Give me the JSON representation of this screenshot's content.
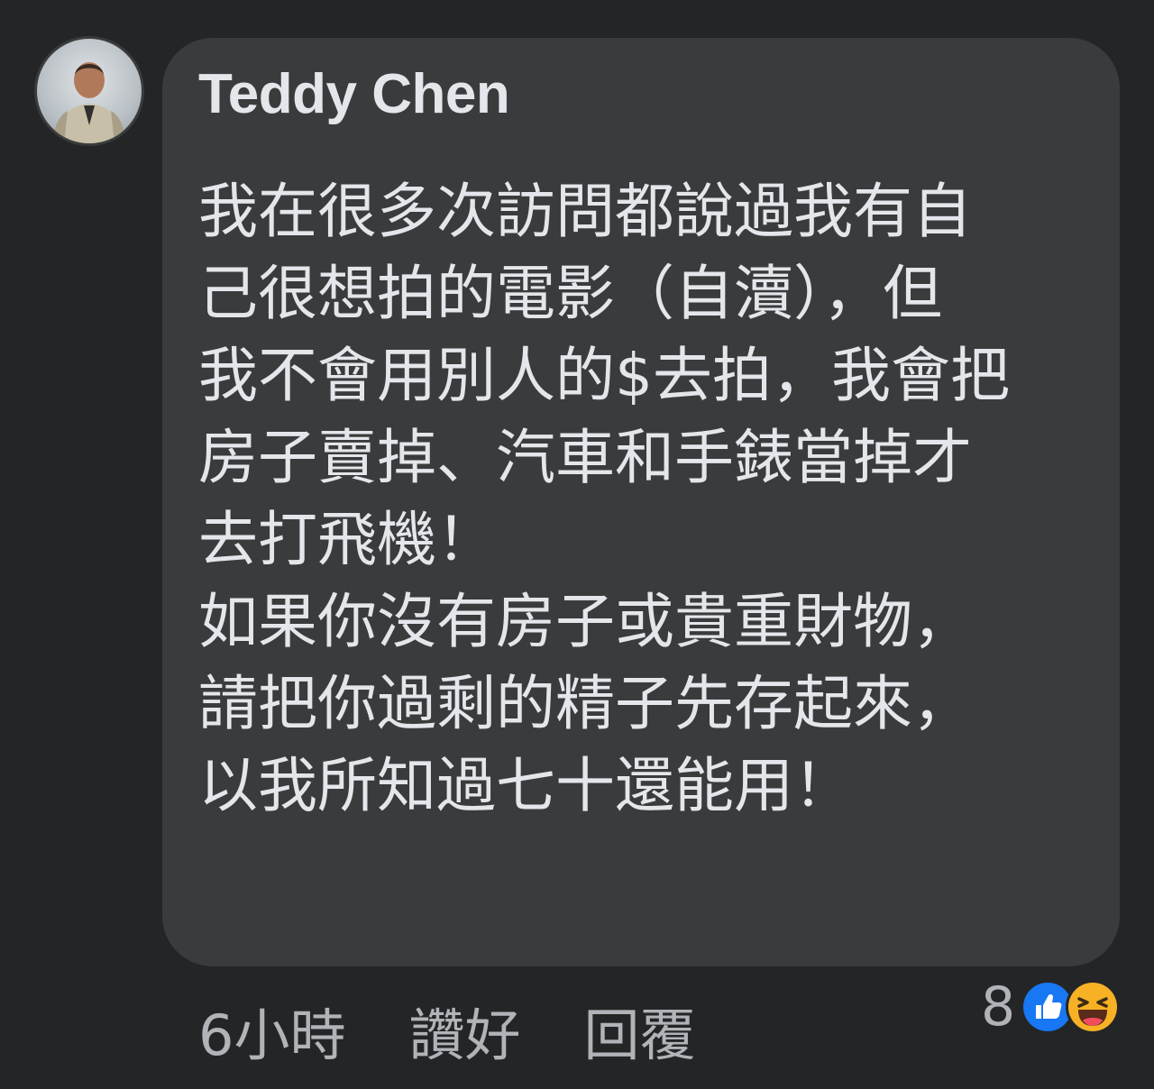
{
  "comment": {
    "author": "Teddy Chen",
    "lines": [
      "我在很多次訪問都說過我有自",
      "己很想拍的電影（自瀆），但",
      "我不會用別人的$去拍，我會把",
      "房子賣掉、汽車和手錶當掉才",
      "去打飛機！",
      "如果你沒有房子或貴重財物，",
      "請把你過剩的精子先存起來，",
      "以我所知過七十還能用！"
    ]
  },
  "actions": {
    "timestamp": "6小時",
    "like_label": "讚好",
    "reply_label": "回覆"
  },
  "reactions": {
    "count": "8",
    "icons": [
      "like-icon",
      "haha-icon"
    ]
  },
  "colors": {
    "background": "#242526",
    "bubble": "#3a3b3c",
    "text_primary": "#e4e6eb",
    "text_secondary": "#b0b3b8",
    "like_blue": "#1877f2",
    "haha_yellow": "#f7b125"
  }
}
